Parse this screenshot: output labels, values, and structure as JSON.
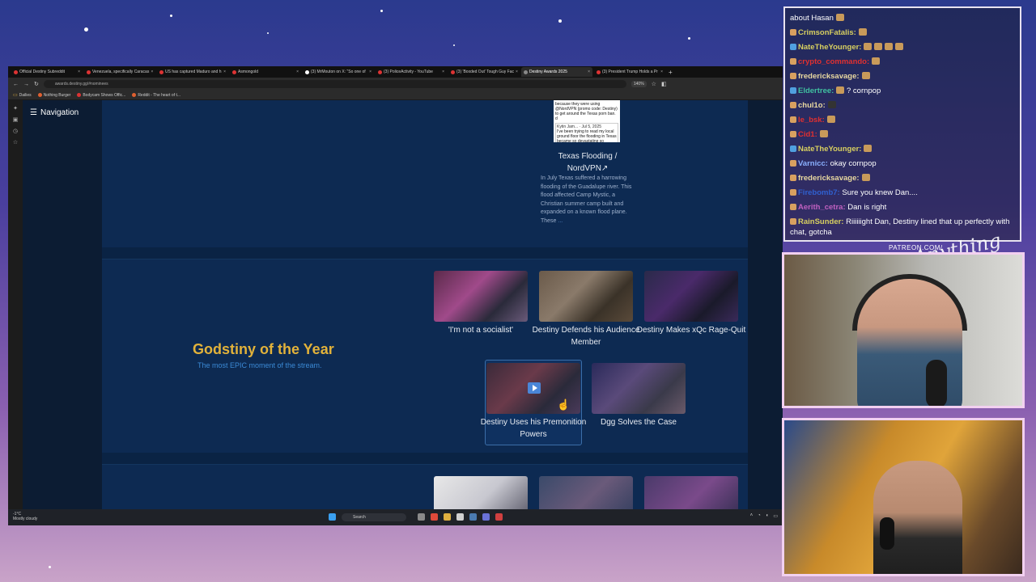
{
  "browser": {
    "tabs": [
      {
        "label": "Official Destiny Subreddit"
      },
      {
        "label": "Venezuela, specifically Caracas"
      },
      {
        "label": "US has captured Maduro and h"
      },
      {
        "label": "Asmongold"
      },
      {
        "label": "(3) MrMouton on X: \"So one of"
      },
      {
        "label": "(3) PoliceActivity - YouTube"
      },
      {
        "label": "(3) 'Boxded Out' Tough Guy Fac"
      },
      {
        "label": "Destiny Awards 2025"
      },
      {
        "label": "(3) President Trump Holds a Pr"
      }
    ],
    "url": "awards.destiny.gg/#nominees",
    "zoom": "140%",
    "bookmarks": [
      "Dailies",
      "Nothing Burger",
      "Bodycam Shows Offic...",
      "Reddit - The heart of t..."
    ]
  },
  "page": {
    "nav_label": "Navigation",
    "texas": {
      "thumb_text": "because they were using @NordVPN (promo code: Destiny) to get around the Texas porn ban. d",
      "thumb_meta": "Kytin Jam... · Jul 5, 2025",
      "thumb_body": "I've been trying to read my local ground floor the flooding in Texas became so devastating so quickly. Why not evacuate?",
      "title": "Texas Flooding / NordVPN↗",
      "description": "In July Texas suffered a harrowing flooding of the Guadalupe river. This flood affected Camp Mystic, a Christian summer camp built and expanded on a known flood plane. These",
      "more": "..."
    },
    "category": {
      "title": "Godstiny of the Year",
      "subtitle": "The most EPIC moment of the stream.",
      "nominees": [
        {
          "label": "'I'm not a socialist'"
        },
        {
          "label": "Destiny Defends his Audience Member"
        },
        {
          "label": "Destiny Makes xQc Rage-Quit"
        },
        {
          "label": "Destiny Uses his Premonition Powers"
        },
        {
          "label": "Dgg Solves the Case"
        }
      ]
    }
  },
  "taskbar": {
    "weather_temp": "-1°C",
    "weather_desc": "Mostly cloudy",
    "search_placeholder": "Search"
  },
  "chat": {
    "messages": [
      {
        "user": "",
        "text": "about Hasan",
        "color": "#ffffff"
      },
      {
        "user": "CrimsonFatalis:",
        "text": "",
        "color": "#d8d060"
      },
      {
        "user": "NateTheYounger:",
        "text": "",
        "color": "#d8d060"
      },
      {
        "user": "crypto_commando:",
        "text": "",
        "color": "#e03030"
      },
      {
        "user": "fredericksavage:",
        "text": "",
        "color": "#e8d8a0"
      },
      {
        "user": "Eldertree:",
        "text": "? cornpop",
        "color": "#40c0a0"
      },
      {
        "user": "chul1o:",
        "text": "",
        "color": "#e8d8a0"
      },
      {
        "user": "le_bsk:",
        "text": "",
        "color": "#e03030"
      },
      {
        "user": "Cid1:",
        "text": "",
        "color": "#e03030"
      },
      {
        "user": "NateTheYounger:",
        "text": "",
        "color": "#d8d060"
      },
      {
        "user": "Varnicc:",
        "text": "okay cornpop",
        "color": "#8ab0ff"
      },
      {
        "user": "fredericksavage:",
        "text": "",
        "color": "#e8d8a0"
      },
      {
        "user": "Firebomb7:",
        "text": "Sure you knew Dan....",
        "color": "#3060d0"
      },
      {
        "user": "Aerith_cetra:",
        "text": "Dan is right",
        "color": "#c060c0"
      },
      {
        "user": "RainSunder:",
        "text": "Riiiiiight Dan, Destiny lined that up perfectly with chat, gotcha",
        "color": "#d8d060"
      }
    ]
  },
  "overlay": {
    "patreon": "PATREON.COM/",
    "logo": "Anything Else?"
  }
}
